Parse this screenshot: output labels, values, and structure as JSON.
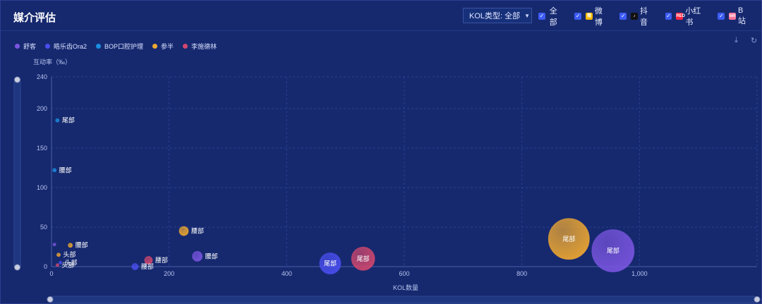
{
  "header": {
    "title": "媒介评估",
    "kol_select": {
      "label": "KOL类型:",
      "value": "全部"
    },
    "filters": [
      {
        "label": "全部",
        "checked": true,
        "icon": "",
        "color": ""
      },
      {
        "label": "微博",
        "checked": true,
        "icon": "weibo-icon",
        "color": "#f5b800"
      },
      {
        "label": "抖音",
        "checked": true,
        "icon": "douyin-icon",
        "color": "#111111"
      },
      {
        "label": "小红书",
        "checked": true,
        "icon": "xiaohongshu-icon",
        "color": "#ff2442"
      },
      {
        "label": "B 站",
        "checked": true,
        "icon": "bilibili-icon",
        "color": "#fb7299"
      }
    ]
  },
  "chart_data": {
    "type": "scatter",
    "title": "",
    "xlabel": "KOL数量",
    "ylabel": "互动率（‰）",
    "xlim": [
      0,
      1200
    ],
    "ylim": [
      0,
      240
    ],
    "xticks": [
      0,
      200,
      400,
      600,
      800,
      1000
    ],
    "xtick_labels": [
      "0",
      "200",
      "400",
      "600",
      "800",
      "1,000"
    ],
    "yticks": [
      0,
      50,
      100,
      150,
      200,
      240
    ],
    "ytick_labels": [
      "0",
      "50",
      "100",
      "150",
      "200",
      "240"
    ],
    "grid": true,
    "legend_position": "top-left",
    "series": [
      {
        "name": "舒客",
        "color": "#7a55e0",
        "points": [
          {
            "x": 5,
            "y": 28,
            "size": 4,
            "label": ""
          },
          {
            "x": 248,
            "y": 13,
            "size": 14,
            "label": "腰部"
          },
          {
            "x": 955,
            "y": 20,
            "size": 60,
            "label": "尾部"
          }
        ]
      },
      {
        "name": "皓乐齿Ora2",
        "color": "#4a4ef0",
        "points": [
          {
            "x": 15,
            "y": 5,
            "size": 4,
            "label": "头部"
          },
          {
            "x": 142,
            "y": 0,
            "size": 9,
            "label": "腰部"
          },
          {
            "x": 474,
            "y": 4,
            "size": 30,
            "label": "尾部"
          }
        ]
      },
      {
        "name": "BOP口腔护理",
        "color": "#1a8fe0",
        "points": [
          {
            "x": 10,
            "y": 185,
            "size": 5,
            "label": "尾部"
          },
          {
            "x": 5,
            "y": 122,
            "size": 5,
            "label": "腰部"
          }
        ]
      },
      {
        "name": "参半",
        "color": "#f0a830",
        "points": [
          {
            "x": 12,
            "y": 15,
            "size": 5,
            "label": "头部"
          },
          {
            "x": 32,
            "y": 27,
            "size": 6,
            "label": "腰部"
          },
          {
            "x": 225,
            "y": 45,
            "size": 13,
            "label": "腰部"
          },
          {
            "x": 880,
            "y": 35,
            "size": 58,
            "label": "尾部"
          }
        ]
      },
      {
        "name": "李施德林",
        "color": "#d2476e",
        "points": [
          {
            "x": 10,
            "y": 2,
            "size": 4,
            "label": "头部"
          },
          {
            "x": 165,
            "y": 8,
            "size": 11,
            "label": "腰部"
          },
          {
            "x": 530,
            "y": 10,
            "size": 33,
            "label": "尾部"
          }
        ]
      }
    ]
  }
}
